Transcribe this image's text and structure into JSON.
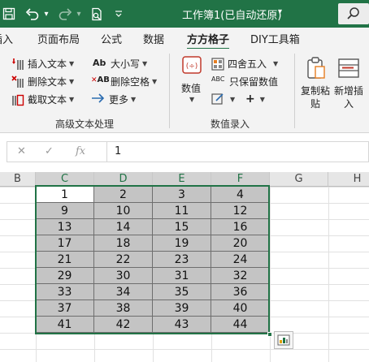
{
  "titlebar": {
    "title": "工作簿1(已自动还原)",
    "title_caret": "▾",
    "qat_caret": "▾"
  },
  "tabs": [
    {
      "label": "插入"
    },
    {
      "label": "页面布局"
    },
    {
      "label": "公式"
    },
    {
      "label": "数据"
    },
    {
      "label": "方方格子",
      "active": true
    },
    {
      "label": "DIY工具箱"
    }
  ],
  "ribbon": {
    "advanced_text": {
      "group_label": "高级文本处理",
      "insert_text": "插入文本",
      "delete_text": "删除文本",
      "cut_text": "截取文本",
      "case": "大小写",
      "delete_space": "删除空格",
      "more": "更多"
    },
    "data_entry": {
      "group_label": "数值录入",
      "value": "数值",
      "round": "四舍五入",
      "keep_value": "只保留数值",
      "plus": "+"
    },
    "copy_paste": "复制粘贴",
    "new_insert": "新增插入"
  },
  "formula_bar": {
    "cancel_symbol": "✕",
    "confirm_symbol": "✓",
    "fx_label": "fx",
    "value": "1"
  },
  "sheet": {
    "column_headers": [
      "B",
      "C",
      "D",
      "E",
      "F",
      "G",
      "H"
    ],
    "rows": [
      [
        "1",
        "2",
        "3",
        "4"
      ],
      [
        "9",
        "10",
        "11",
        "12"
      ],
      [
        "13",
        "14",
        "15",
        "16"
      ],
      [
        "17",
        "18",
        "19",
        "20"
      ],
      [
        "21",
        "22",
        "23",
        "24"
      ],
      [
        "29",
        "30",
        "31",
        "32"
      ],
      [
        "33",
        "34",
        "35",
        "36"
      ],
      [
        "37",
        "38",
        "39",
        "40"
      ],
      [
        "41",
        "42",
        "43",
        "44"
      ]
    ],
    "accent_color": "#217346",
    "fill_color": "#c4c4c4"
  }
}
